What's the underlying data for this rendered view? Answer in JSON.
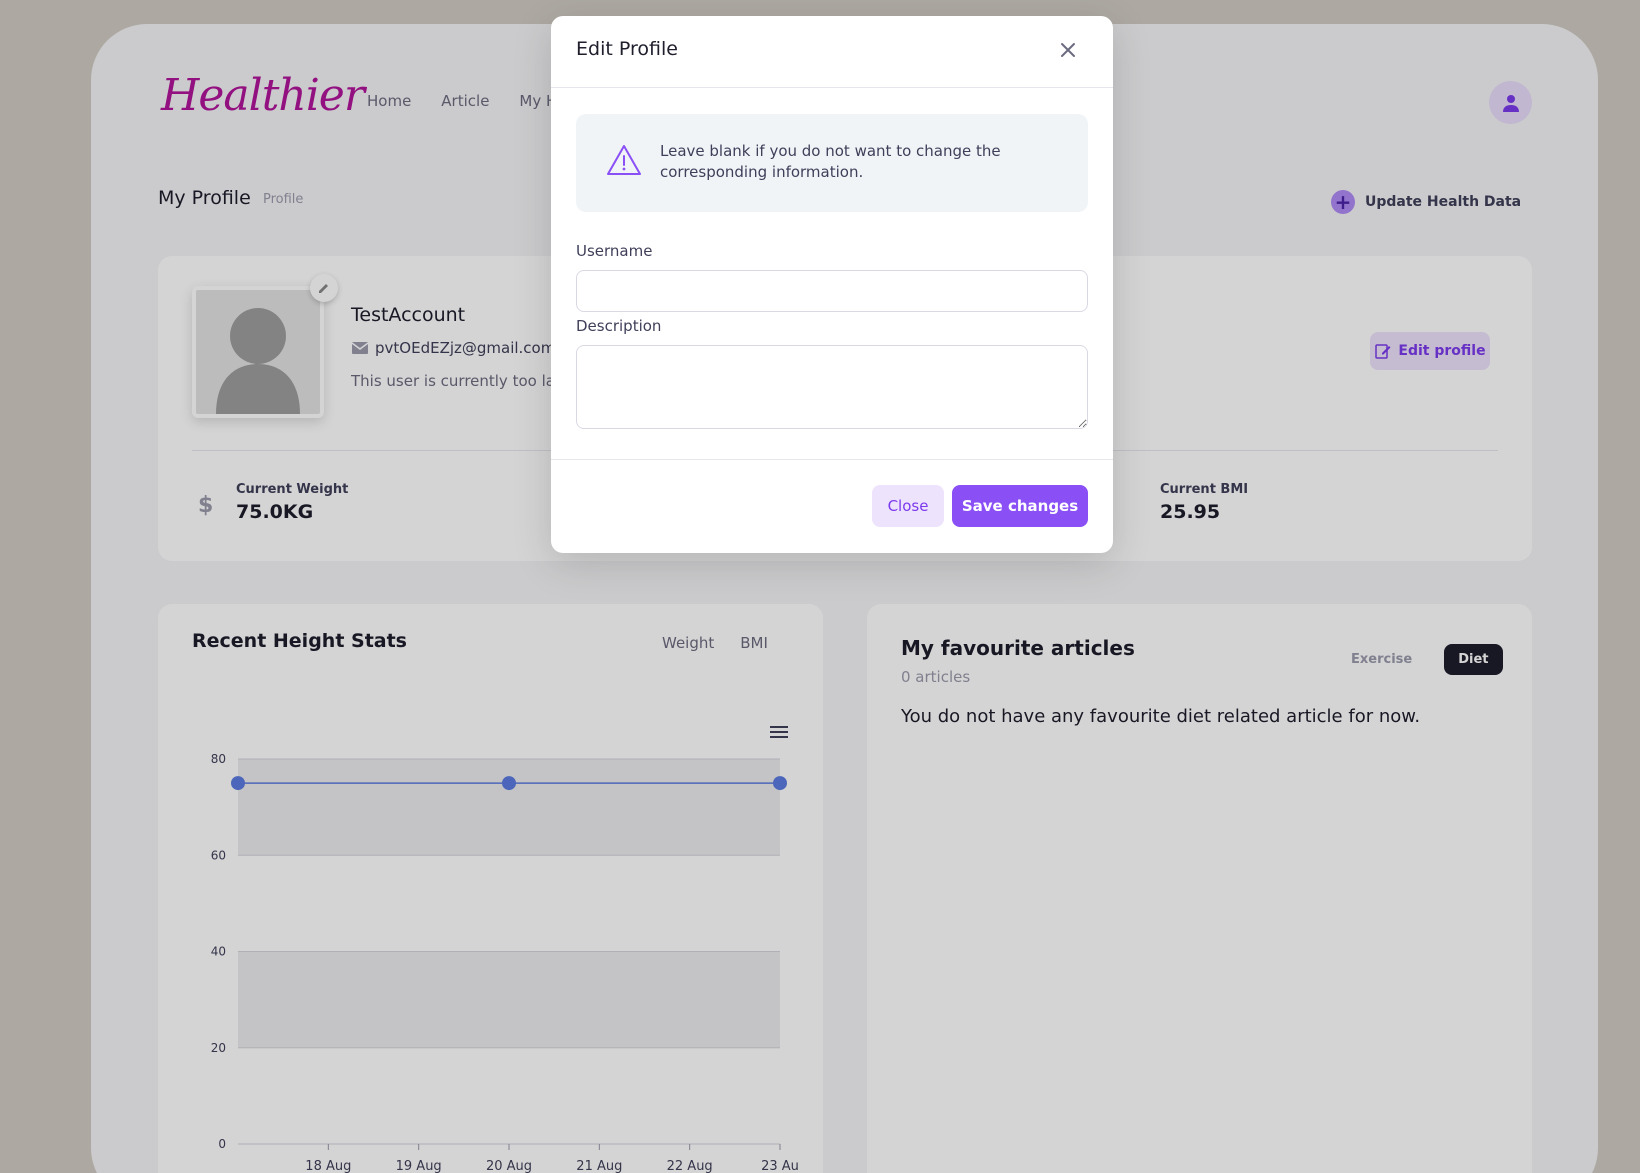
{
  "brand": {
    "logo_text": "Healthier"
  },
  "nav": {
    "items": [
      "Home",
      "Article",
      "My H"
    ]
  },
  "page": {
    "title": "My Profile",
    "crumb": "Profile",
    "update_health_label": "Update Health Data"
  },
  "profile": {
    "username": "TestAccount",
    "email": "pvtOEdEZjz@gmail.com",
    "description": "This user is currently too laz",
    "edit_button": "Edit profile"
  },
  "stats": {
    "weight_label": "Current Weight",
    "weight_value": "75.0KG",
    "weight_icon": "$",
    "bmi_label": "Current BMI",
    "bmi_value": "25.95"
  },
  "chart_panel": {
    "title": "Recent Height Stats",
    "tabs": [
      "Weight",
      "BMI"
    ]
  },
  "chart_data": {
    "type": "line",
    "x": [
      "18 Aug",
      "19 Aug",
      "20 Aug",
      "21 Aug",
      "22 Aug",
      "23 Au"
    ],
    "series": [
      {
        "points": [
          [
            0,
            75
          ],
          [
            3,
            75
          ],
          [
            6,
            75
          ]
        ]
      }
    ],
    "y_ticks": [
      0,
      20,
      40,
      60,
      80
    ],
    "ylim": [
      0,
      80
    ],
    "color": "#5b7be0"
  },
  "articles": {
    "title": "My favourite articles",
    "count": "0 articles",
    "empty_text": "You do not have any favourite diet related article for now.",
    "tabs": [
      "Exercise",
      "Diet"
    ]
  },
  "modal": {
    "title": "Edit Profile",
    "notice": "Leave blank if you do not want to change the corresponding information.",
    "username_label": "Username",
    "username_value": "",
    "description_label": "Description",
    "description_value": "",
    "close_label": "Close",
    "save_label": "Save changes"
  },
  "colors": {
    "accent": "#8b4ff6",
    "logo": "#b0149a",
    "dark": "#1e1e2d"
  }
}
